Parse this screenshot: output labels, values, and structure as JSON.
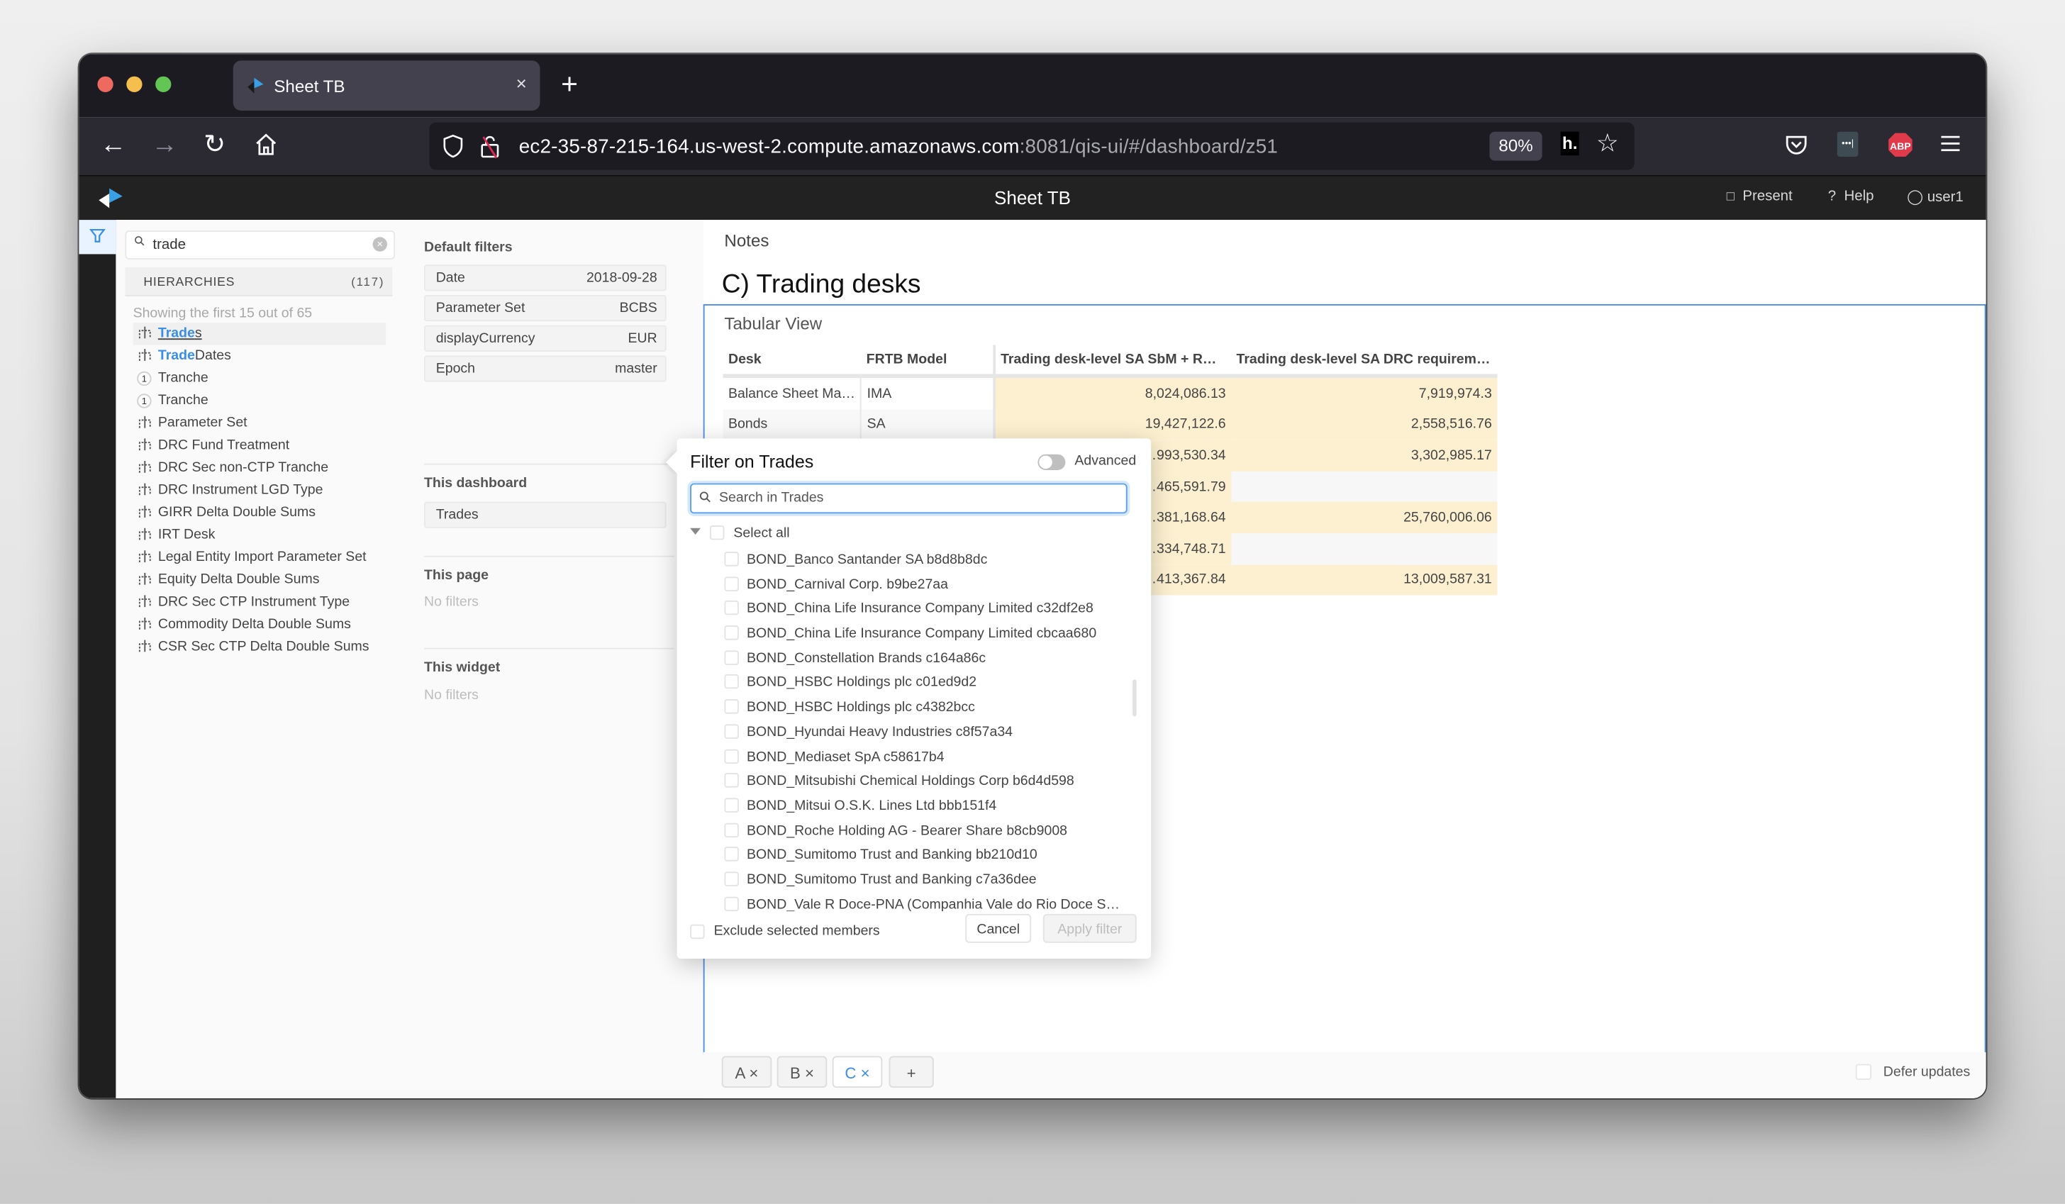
{
  "browser": {
    "tab_title": "Sheet TB",
    "tab_close": "×",
    "new_tab": "+",
    "url_host": "ec2-35-87-215-164.us-west-2.compute.amazonaws.com",
    "url_rest": ":8081/qis-ui/#/dashboard/z51",
    "zoom_level": "80%",
    "ext_h_label": "h.",
    "abp_label": "ABP"
  },
  "app": {
    "title": "Sheet TB",
    "actions": {
      "present": "Present",
      "help": "Help",
      "user": "user1"
    }
  },
  "data_model": {
    "search_value": "trade",
    "section_label": "HIERARCHIES",
    "section_count": "(117)",
    "showing_text": "Showing the first 15 out of 65",
    "items": [
      {
        "icon": "hierarchy-icon",
        "match": "Trade",
        "rest": "s",
        "selected": true
      },
      {
        "icon": "hierarchy-icon",
        "match": "Trade",
        "rest": "Dates",
        "selected": false
      },
      {
        "icon": "level-1-badge",
        "badge": "1",
        "match": "",
        "rest": "Tranche",
        "selected": false
      },
      {
        "icon": "level-1-badge",
        "badge": "1",
        "match": "",
        "rest": "Tranche",
        "selected": false
      },
      {
        "icon": "hierarchy-icon",
        "match": "",
        "rest": "Parameter Set",
        "selected": false
      },
      {
        "icon": "hierarchy-icon",
        "match": "",
        "rest": "DRC Fund Treatment",
        "selected": false
      },
      {
        "icon": "hierarchy-icon",
        "match": "",
        "rest": "DRC Sec non-CTP Tranche",
        "selected": false
      },
      {
        "icon": "hierarchy-icon",
        "match": "",
        "rest": "DRC Instrument LGD Type",
        "selected": false
      },
      {
        "icon": "hierarchy-icon",
        "match": "",
        "rest": "GIRR Delta Double Sums",
        "selected": false
      },
      {
        "icon": "hierarchy-icon",
        "match": "",
        "rest": "IRT Desk",
        "selected": false
      },
      {
        "icon": "hierarchy-icon",
        "match": "",
        "rest": "Legal Entity Import Parameter Set",
        "selected": false
      },
      {
        "icon": "hierarchy-icon",
        "match": "",
        "rest": "Equity Delta Double Sums",
        "selected": false
      },
      {
        "icon": "hierarchy-icon",
        "match": "",
        "rest": "DRC Sec CTP Instrument Type",
        "selected": false
      },
      {
        "icon": "hierarchy-icon",
        "match": "",
        "rest": "Commodity Delta Double Sums",
        "selected": false
      },
      {
        "icon": "hierarchy-icon",
        "match": "",
        "rest": "CSR Sec CTP Delta Double Sums",
        "selected": false
      }
    ]
  },
  "filters": {
    "default_title": "Default filters",
    "default_items": [
      {
        "key": "Date",
        "value": "2018-09-28"
      },
      {
        "key": "Parameter Set",
        "value": "BCBS"
      },
      {
        "key": "displayCurrency",
        "value": "EUR"
      },
      {
        "key": "Epoch",
        "value": "master"
      }
    ],
    "dashboard_title": "This dashboard",
    "dashboard_items": [
      {
        "key": "Trades"
      }
    ],
    "page_title": "This page",
    "page_empty": "No filters",
    "widget_title": "This widget",
    "widget_empty": "No filters"
  },
  "main": {
    "notes": "Notes",
    "page_title": "C) Trading desks",
    "widget_title": "Tabular View",
    "table": {
      "columns": [
        "Desk",
        "FRTB Model",
        "Trading desk-level SA SbM + R…",
        "Trading desk-level SA DRC requirem…"
      ],
      "rows": [
        [
          "Balance Sheet Ma…",
          "IMA",
          "8,024,086.13",
          "7,919,974.3"
        ],
        [
          "Bonds",
          "SA",
          "19,427,122.6",
          "2,558,516.76"
        ],
        [
          "",
          "",
          "…993,530.34",
          "3,302,985.17"
        ],
        [
          "",
          "",
          "…465,591.79",
          ""
        ],
        [
          "",
          "",
          "…381,168.64",
          "25,760,006.06"
        ],
        [
          "",
          "",
          "…334,748.71",
          ""
        ],
        [
          "",
          "",
          "…413,367.84",
          "13,009,587.31"
        ]
      ]
    },
    "page_tabs": [
      {
        "label": "A",
        "close": "×",
        "active": false
      },
      {
        "label": "B",
        "close": "×",
        "active": false
      },
      {
        "label": "C",
        "close": "×",
        "active": true
      }
    ],
    "add_page": "+",
    "defer_updates": "Defer updates"
  },
  "popup": {
    "title": "Filter on Trades",
    "advanced_label": "Advanced",
    "advanced_on": false,
    "search_placeholder": "Search in Trades",
    "select_all": "Select all",
    "members": [
      "BOND_Banco Santander SA b8d8b8dc",
      "BOND_Carnival Corp. b9be27aa",
      "BOND_China Life Insurance Company Limited c32df2e8",
      "BOND_China Life Insurance Company Limited cbcaa680",
      "BOND_Constellation Brands c164a86c",
      "BOND_HSBC Holdings plc c01ed9d2",
      "BOND_HSBC Holdings plc c4382bcc",
      "BOND_Hyundai Heavy Industries c8f57a34",
      "BOND_Mediaset SpA c58617b4",
      "BOND_Mitsubishi Chemical Holdings Corp b6d4d598",
      "BOND_Mitsui O.S.K. Lines Ltd bbb151f4",
      "BOND_Roche Holding AG - Bearer Share b8cb9008",
      "BOND_Sumitomo Trust and Banking bb210d10",
      "BOND_Sumitomo Trust and Banking c7a36dee",
      "BOND_Vale R Doce-PNA (Companhia Vale do Rio Doce SA…"
    ],
    "exclude_label": "Exclude selected members",
    "cancel": "Cancel",
    "apply": "Apply filter"
  },
  "colors": {
    "accent": "#3b8ee8",
    "measure_cell": "#fcf0d0",
    "app_header": "#222222",
    "browser_chrome": "#2b2a33"
  }
}
